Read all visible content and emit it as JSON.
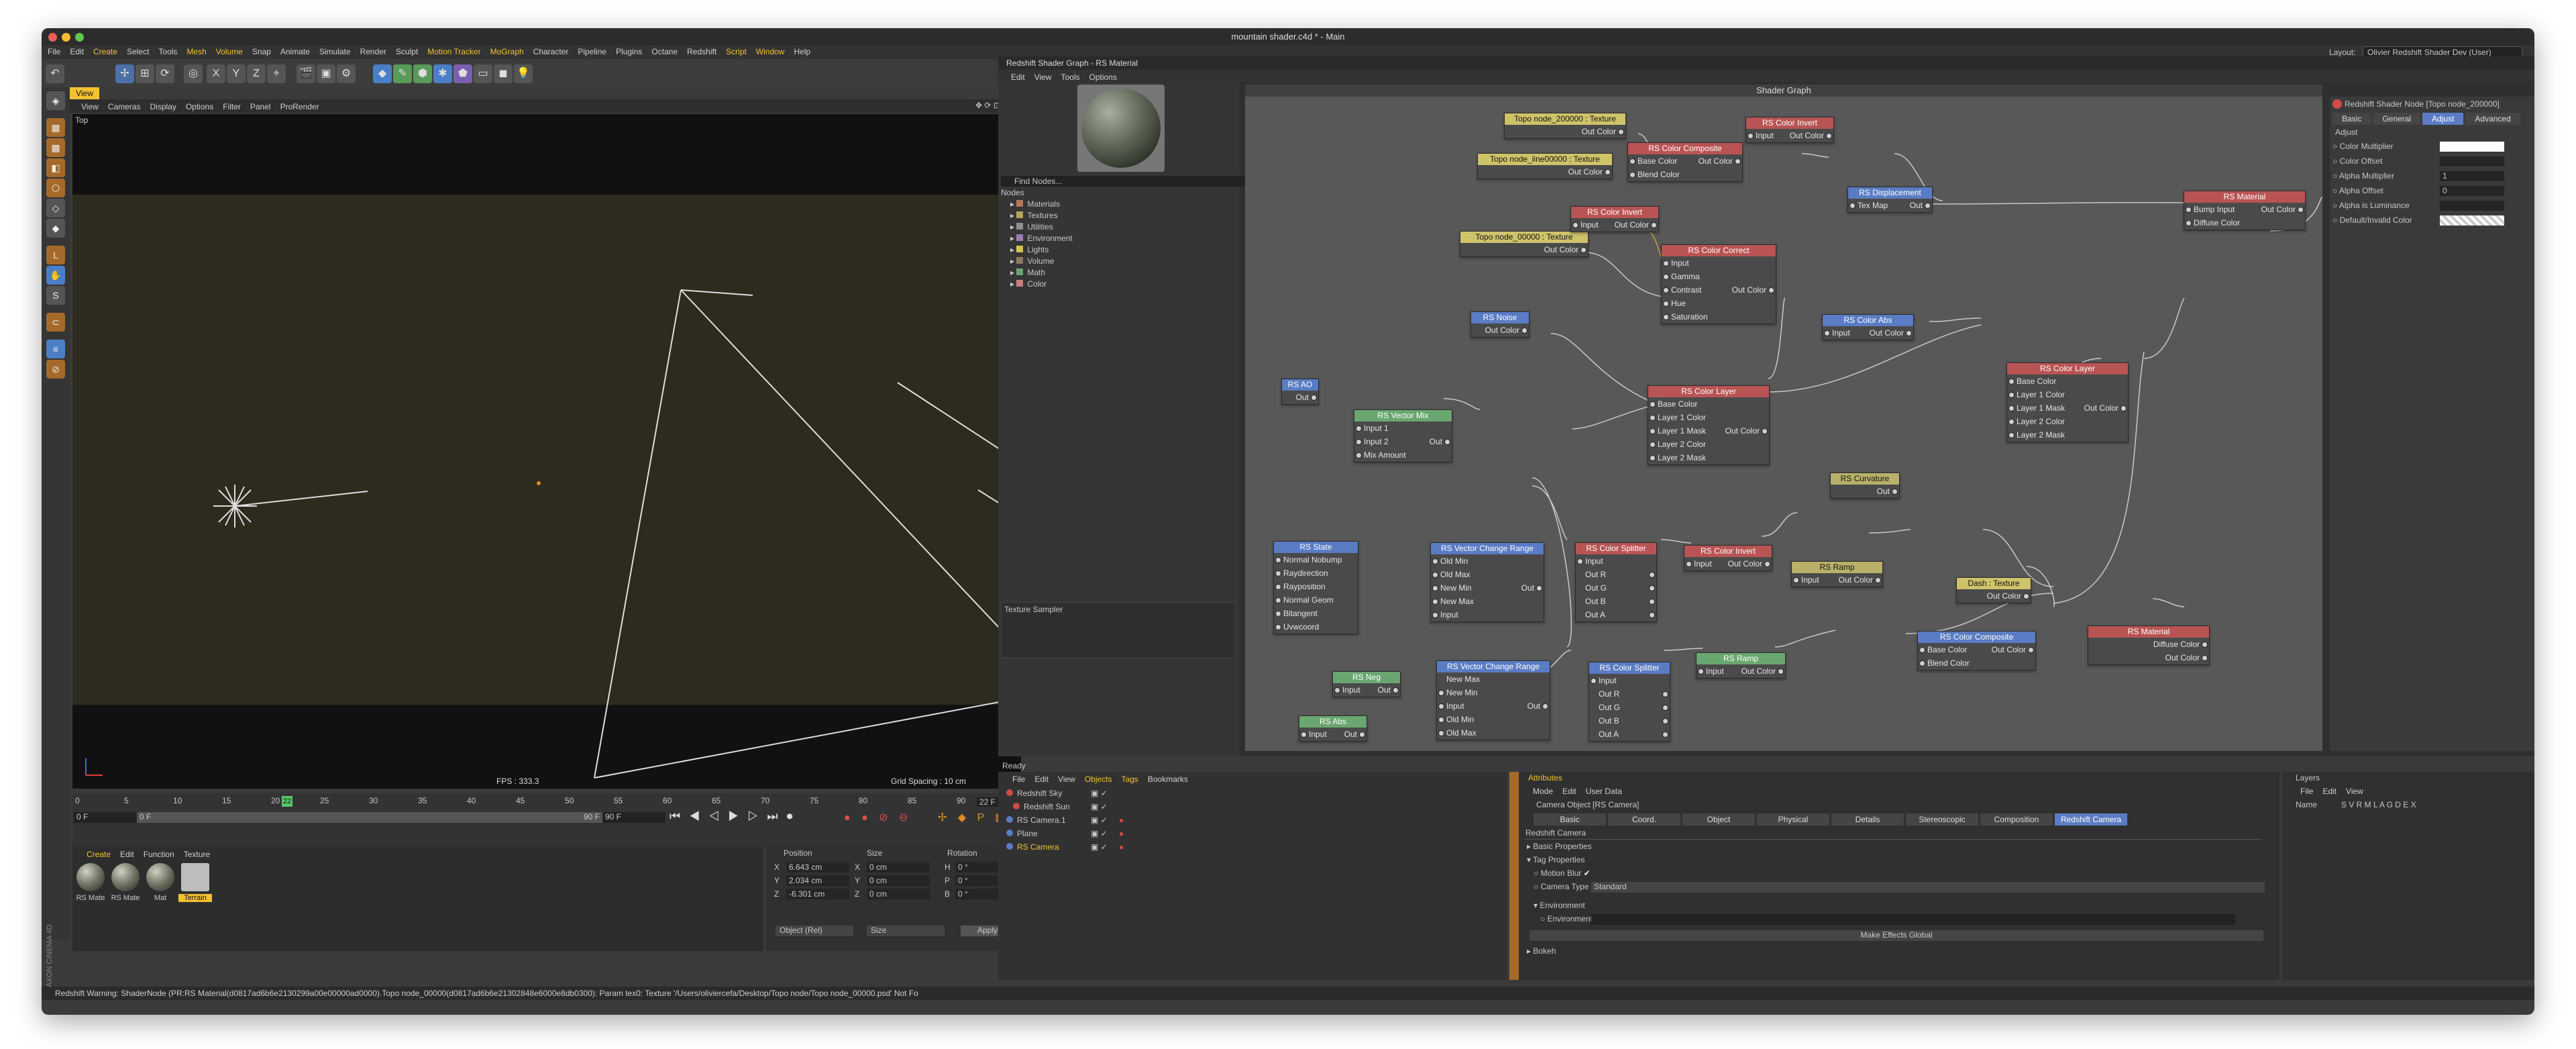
{
  "window": {
    "title": "mountain shader.c4d * - Main",
    "layout_label": "Layout:",
    "layout_value": "Olivier Redshift Shader Dev (User)"
  },
  "menu": [
    "File",
    "Edit",
    "Create",
    "Select",
    "Tools",
    "Mesh",
    "Volume",
    "Snap",
    "Animate",
    "Simulate",
    "Render",
    "Sculpt",
    "Motion Tracker",
    "MoGraph",
    "Character",
    "Pipeline",
    "Plugins",
    "Octane",
    "Redshift",
    "Script",
    "Window",
    "Help"
  ],
  "toolbar": {
    "x": "X",
    "y": "Y",
    "z": "Z"
  },
  "viewport": {
    "tab": "View",
    "menu": [
      "View",
      "Cameras",
      "Display",
      "Options",
      "Filter",
      "Panel",
      "ProRender"
    ],
    "view_name": "Top",
    "fps": "FPS : 333.3",
    "grid_spacing": "Grid Spacing : 10 cm"
  },
  "timeline": {
    "ticks": [
      "0",
      "5",
      "10",
      "15",
      "20",
      "25",
      "30",
      "35",
      "40",
      "45",
      "50",
      "55",
      "60",
      "65",
      "70",
      "75",
      "80",
      "85",
      "90"
    ],
    "current_frame": "22",
    "frame_field": "22 F",
    "start": "0 F",
    "start2": "0 F",
    "end": "90 F",
    "end2": "90 F"
  },
  "materials": {
    "menu": [
      "Create",
      "Edit",
      "Function",
      "Texture"
    ],
    "items": [
      "RS Mate",
      "RS Mate",
      "Mat",
      "Terrain"
    ]
  },
  "coords": {
    "headers": [
      "Position",
      "Size",
      "Rotation"
    ],
    "rows": [
      [
        "X",
        "6.643 cm",
        "X",
        "0 cm",
        "H",
        "0 °"
      ],
      [
        "Y",
        "2.034 cm",
        "Y",
        "0 cm",
        "P",
        "0 °"
      ],
      [
        "Z",
        "-6.301 cm",
        "Z",
        "0 cm",
        "B",
        "0 °"
      ]
    ],
    "mode": "Object (Rel)",
    "size_mode": "Size",
    "apply": "Apply"
  },
  "status": "Redshift Warning: ShaderNode (PR:RS Material(d0817ad6b6e2130299a00e00000ad0000).Topo node_00000(d0817ad6b6e21302848e6000e8db0300): Param tex0: Texture '/Users/oliviercefa/Desktop/Topo node/Topo node_00000.psd' Not Fo",
  "shader_graph": {
    "title": "Redshift Shader Graph - RS Material",
    "menu": [
      "Edit",
      "View",
      "Tools",
      "Options"
    ],
    "find_nodes": "Find Nodes...",
    "nodes_label": "Nodes",
    "categories": [
      "Materials",
      "Textures",
      "Utilities",
      "Environment",
      "Lights",
      "Volume",
      "Math",
      "Color"
    ],
    "category_colors": [
      "#b5775a",
      "#b5a35a",
      "#8f8f8f",
      "#9d7fb5",
      "#d2c34e",
      "#8c7a60",
      "#6aa770",
      "#cc7f7f"
    ],
    "texture_sampler": "Texture Sampler",
    "canvas_title": "Shader Graph",
    "nodes": {
      "tex200000": {
        "title": "Topo node_200000 : Texture",
        "out": "Out Color"
      },
      "texline": {
        "title": "Topo node_line00000 : Texture",
        "out": "Out Color"
      },
      "tex00000": {
        "title": "Topo node_00000 : Texture",
        "out": "Out Color"
      },
      "comp1": {
        "title": "RS Color Composite",
        "p": [
          "Base Color",
          "Blend Color"
        ],
        "out": "Out Color"
      },
      "inv1": {
        "title": "RS Color Invert",
        "in": "Input",
        "out": "Out Color"
      },
      "inv2": {
        "title": "RS Color Invert",
        "in": "Input",
        "out": "Out Color"
      },
      "disp": {
        "title": "RS Displacement",
        "in": "Tex Map",
        "out": "Out"
      },
      "mat1": {
        "title": "RS Material",
        "p": [
          "Bump Input",
          "Diffuse Color"
        ],
        "out": "Out Color"
      },
      "cc": {
        "title": "RS Color Correct",
        "p": [
          "Input",
          "Gamma",
          "Contrast",
          "Hue",
          "Saturation"
        ],
        "out": "Out Color"
      },
      "noise": {
        "title": "RS Noise",
        "out": "Out Color"
      },
      "abs1": {
        "title": "RS Color Abs",
        "in": "Input",
        "out": "Out Color"
      },
      "layer2": {
        "title": "RS Color Layer",
        "p": [
          "Base Color",
          "Layer 1 Color",
          "Layer 1 Mask",
          "Layer 2 Color",
          "Layer 2 Mask"
        ],
        "out": "Out Color"
      },
      "ao": {
        "title": "RS AO",
        "out": "Out"
      },
      "vmix": {
        "title": "RS Vector Mix",
        "p": [
          "Input 1",
          "Input 2",
          "Mix Amount"
        ],
        "out": "Out"
      },
      "layer1": {
        "title": "RS Color Layer",
        "p": [
          "Base Color",
          "Layer 1 Color",
          "Layer 1 Mask",
          "Layer 2 Color",
          "Layer 2 Mask"
        ],
        "out": "Out Color"
      },
      "curv": {
        "title": "RS Curvature",
        "out": "Out"
      },
      "state": {
        "title": "RS State",
        "p": [
          "Normal Nobump",
          "Raydirection",
          "Rayposition",
          "Normal Geom",
          "Bitangent",
          "Uvwcoord"
        ]
      },
      "vcr1": {
        "title": "RS Vector Change Range",
        "p": [
          "Old Min",
          "Old Max",
          "New Min",
          "New Max",
          "Input"
        ],
        "out": "Out"
      },
      "split1": {
        "title": "RS Color Splitter",
        "in": "Input",
        "p": [
          "Out R",
          "Out G",
          "Out B",
          "Out A"
        ]
      },
      "inv3": {
        "title": "RS Color Invert",
        "in": "Input",
        "out": "Out Color"
      },
      "ramp1": {
        "title": "RS Ramp",
        "in": "Input",
        "out": "Out Color"
      },
      "dash": {
        "title": "Dash : Texture",
        "out": "Out Color"
      },
      "mat2": {
        "title": "RS Material",
        "out": "Diffuse Color",
        "out2": "Out Color"
      },
      "comp2": {
        "title": "RS Color Composite",
        "p": [
          "Base Color",
          "Blend Color"
        ],
        "out": "Out Color"
      },
      "neg": {
        "title": "RS Neg",
        "in": "Input",
        "out": "Out"
      },
      "vcr2": {
        "title": "RS Vector Change Range",
        "p": [
          "New Min",
          "Input",
          "Old Min",
          "Old Max"
        ],
        "out": "Out",
        "p0": "New Max"
      },
      "split2": {
        "title": "RS Color Splitter",
        "in": "Input",
        "p": [
          "Out R",
          "Out G",
          "Out B",
          "Out A"
        ]
      },
      "ramp2": {
        "title": "RS Ramp",
        "in": "Input",
        "out": "Out Color"
      },
      "abs2": {
        "title": "RS Abs",
        "in": "Input",
        "out": "Out"
      }
    },
    "node_attr": {
      "header": "Redshift Shader Node [Topo node_200000]",
      "tabs": [
        "Basic",
        "General",
        "Adjust",
        "Advanced"
      ],
      "section": "Adjust",
      "rows": [
        [
          "Color Multiplier",
          ""
        ],
        [
          "Color Offset",
          ""
        ],
        [
          "Alpha Multiplier",
          "1"
        ],
        [
          "Alpha Offset",
          "0"
        ],
        [
          "Alpha is Luminance",
          ""
        ],
        [
          "Default/Invalid Color",
          ""
        ]
      ]
    }
  },
  "ready": "Ready",
  "objects": {
    "menu": [
      "File",
      "Edit",
      "View",
      "Objects",
      "Tags",
      "Bookmarks"
    ],
    "items": [
      "Redshift Sky",
      "Redshift Sun",
      "RS Camera.1",
      "Plane",
      "RS Camera"
    ]
  },
  "attributes": {
    "title": "Attributes",
    "menu": [
      "Mode",
      "Edit",
      "User Data"
    ],
    "object": "Camera Object [RS Camera]",
    "tabs": [
      "Basic",
      "Coord.",
      "Object",
      "Physical",
      "Details",
      "Stereoscopic",
      "Composition",
      "Redshift Camera"
    ],
    "section": "Redshift Camera",
    "rows": [
      "Basic Properties",
      "Tag Properties"
    ],
    "motion_blur": "Motion Blur",
    "camera_type": "Camera Type",
    "camera_type_value": "Standard",
    "environment_hdr": "Environment",
    "environment": "Environment",
    "make_effects": "Make Effects Global",
    "bokeh": "Bokeh"
  },
  "layers": {
    "title": "Layers",
    "menu": [
      "File",
      "Edit",
      "View"
    ],
    "name": "Name",
    "cols": "S V R M L A G D E X"
  },
  "side_label": "MAXON CINEMA 4D"
}
